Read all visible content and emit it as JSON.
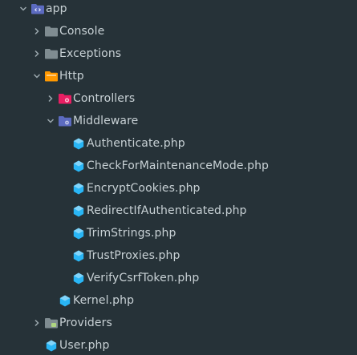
{
  "colors": {
    "background": "#263238",
    "text": "#c8d1d5",
    "chevron": "#9aa7ad",
    "folder_gray": "#7f8c91",
    "folder_app": "#5c6bc0",
    "folder_http": "#ff9800",
    "folder_controllers": "#e91e63",
    "folder_middleware": "#5c6bc0",
    "php_file": "#29b6f6"
  },
  "tree": {
    "app": {
      "label": "app",
      "expanded": true,
      "icon": "folder-app-icon"
    },
    "console": {
      "label": "Console",
      "expanded": false,
      "icon": "folder-icon"
    },
    "exceptions": {
      "label": "Exceptions",
      "expanded": false,
      "icon": "folder-icon"
    },
    "http": {
      "label": "Http",
      "expanded": true,
      "icon": "folder-http-icon"
    },
    "controllers": {
      "label": "Controllers",
      "expanded": false,
      "icon": "folder-controllers-icon"
    },
    "middleware": {
      "label": "Middleware",
      "expanded": true,
      "icon": "folder-middleware-icon"
    },
    "middleware_files": [
      {
        "label": "Authenticate.php",
        "icon": "php-file-icon"
      },
      {
        "label": "CheckForMaintenanceMode.php",
        "icon": "php-file-icon"
      },
      {
        "label": "EncryptCookies.php",
        "icon": "php-file-icon"
      },
      {
        "label": "RedirectIfAuthenticated.php",
        "icon": "php-file-icon"
      },
      {
        "label": "TrimStrings.php",
        "icon": "php-file-icon"
      },
      {
        "label": "TrustProxies.php",
        "icon": "php-file-icon"
      },
      {
        "label": "VerifyCsrfToken.php",
        "icon": "php-file-icon"
      }
    ],
    "kernel": {
      "label": "Kernel.php",
      "icon": "php-file-icon"
    },
    "providers": {
      "label": "Providers",
      "expanded": false,
      "icon": "folder-icon"
    },
    "user": {
      "label": "User.php",
      "icon": "php-file-icon"
    }
  }
}
